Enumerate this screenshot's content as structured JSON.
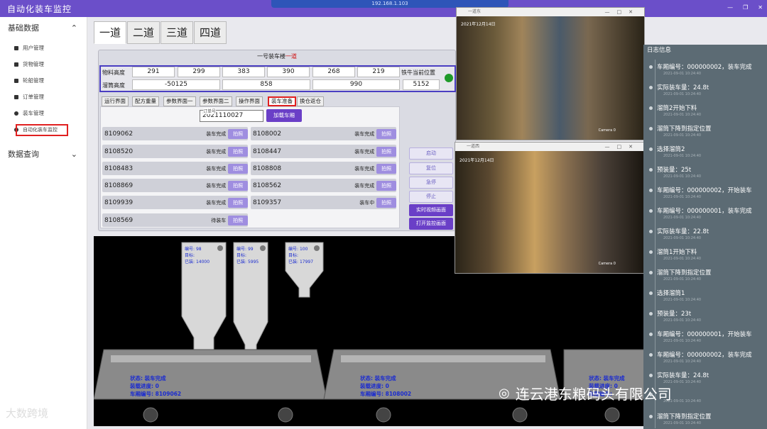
{
  "app": {
    "title": "自动化装车监控"
  },
  "rdp": {
    "host": "192.168.1.103"
  },
  "sidebar": {
    "group1": "基础数据",
    "items": [
      {
        "label": "用户管理",
        "icon": "user-icon"
      },
      {
        "label": "货物管理",
        "icon": "cargo-icon"
      },
      {
        "label": "轮船管理",
        "icon": "ship-icon"
      },
      {
        "label": "订单管理",
        "icon": "order-icon"
      },
      {
        "label": "装车管理",
        "icon": "loading-icon"
      },
      {
        "label": "自动化装车监控",
        "icon": "monitor-icon"
      }
    ],
    "group2": "数据查询"
  },
  "tabs": [
    "一道",
    "二道",
    "三道",
    "四道"
  ],
  "panel": {
    "title_prefix": "一号装车楼",
    "title_suffix": "一道"
  },
  "measure": {
    "row1_label": "物料高度",
    "row1": [
      "291",
      "299",
      "383",
      "390",
      "268",
      "219"
    ],
    "right_label": "铁牛当前位置",
    "row2_label": "溜筒高度",
    "row2": [
      "-50125",
      "858",
      "990"
    ],
    "position": "5152"
  },
  "subtabs": [
    "运行界面",
    "配方重量",
    "参数界面一",
    "参数界面二",
    "操作界面",
    "装车准备",
    "换仓返仓"
  ],
  "order": {
    "label": "订单号",
    "value": "2021110027",
    "load_button": "加载车厢"
  },
  "cars": [
    {
      "no": "8109062",
      "status": "装车完成",
      "btn": "拍照"
    },
    {
      "no": "8108002",
      "status": "装车完成",
      "btn": "拍照"
    },
    {
      "no": "8108520",
      "status": "装车完成",
      "btn": "拍照"
    },
    {
      "no": "8108447",
      "status": "装车完成",
      "btn": "拍照"
    },
    {
      "no": "8108483",
      "status": "装车完成",
      "btn": "拍照"
    },
    {
      "no": "8108808",
      "status": "装车完成",
      "btn": "拍照"
    },
    {
      "no": "8108869",
      "status": "装车完成",
      "btn": "拍照"
    },
    {
      "no": "8108562",
      "status": "装车完成",
      "btn": "拍照"
    },
    {
      "no": "8109939",
      "status": "装车完成",
      "btn": "拍照"
    },
    {
      "no": "8109357",
      "status": "装车中",
      "btn": "拍照"
    },
    {
      "no": "8108569",
      "status": "待装车",
      "btn": "拍照"
    }
  ],
  "controls": [
    "启动",
    "复位",
    "急停",
    "停止",
    "实时视频画面",
    "打开监控画面"
  ],
  "cameras": [
    {
      "title": "一道东",
      "date": "2021年12月14日",
      "label": "Camera 0"
    },
    {
      "title": "一道西",
      "date": "2021年12月14日",
      "label": "Camera 0"
    }
  ],
  "silos": [
    {
      "no_label": "编号:",
      "no": "98",
      "target_label": "目标:",
      "done_label": "已装:",
      "done": "14000"
    },
    {
      "no_label": "编号:",
      "no": "99",
      "target_label": "目标:",
      "done_label": "已装:",
      "done": "5995"
    },
    {
      "no_label": "编号:",
      "no": "100",
      "target_label": "目标:",
      "done_label": "已装:",
      "done": "17997"
    }
  ],
  "wagons": [
    {
      "status_label": "状态:",
      "status": "装车完成",
      "progress_label": "装载进度:",
      "progress": "0",
      "no_label": "车厢编号:",
      "no": "8109062"
    },
    {
      "status_label": "状态:",
      "status": "装车完成",
      "progress_label": "装载进度:",
      "progress": "0",
      "no_label": "车厢编号:",
      "no": "8108002"
    },
    {
      "status_label": "状态:",
      "status": "装车完成",
      "progress_label": "装载进度:",
      "progress": "0",
      "no_label": "车厢编号:",
      "no": ""
    }
  ],
  "log": {
    "title": "日志信息",
    "entries": [
      "车厢编号：000000002，装车完成",
      "实际装车量：24.8t",
      "溜筒2开始下料",
      "溜筒下降到指定位置",
      "选择溜筒2",
      "预装量：25t",
      "车厢编号：000000002，开始装车",
      "车厢编号：000000001，装车完成",
      "实际装车量：22.8t",
      "溜筒1开始下料",
      "溜筒下降到指定位置",
      "选择溜筒1",
      "预装量：23t",
      "车厢编号：000000001，开始装车",
      "车厢编号：000000002，装车完成",
      "实际装车量：24.8t",
      "",
      "溜筒下降到指定位置"
    ],
    "ts": "2021-09-01 10:24:40"
  },
  "watermarks": {
    "right": "连云港东粮码头有限公司",
    "left": "大数跨境"
  }
}
